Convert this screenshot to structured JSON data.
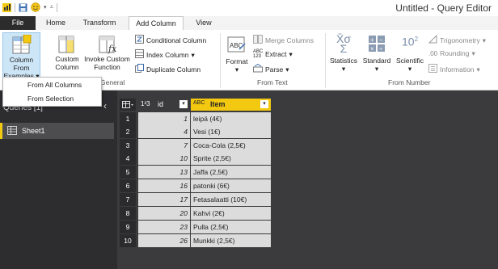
{
  "window": {
    "title": "Untitled - Query Editor"
  },
  "tabs": [
    {
      "label": "File"
    },
    {
      "label": "Home"
    },
    {
      "label": "Transform"
    },
    {
      "label": "Add Column"
    },
    {
      "label": "View"
    }
  ],
  "ribbon": {
    "general": {
      "group_label": "General",
      "column_from_examples": [
        "Column From",
        "Examples"
      ],
      "custom_column": [
        "Custom",
        "Column"
      ],
      "invoke_custom_function": [
        "Invoke Custom",
        "Function"
      ],
      "conditional_column": "Conditional Column",
      "index_column": "Index Column",
      "duplicate_column": "Duplicate Column"
    },
    "from_text": {
      "group_label": "From Text",
      "format": "Format",
      "merge_columns": "Merge Columns",
      "extract": "Extract",
      "parse": "Parse",
      "abc_icon": "ABC",
      "abc123_icon": [
        "ABC",
        "123"
      ]
    },
    "from_number": {
      "group_label": "From Number",
      "statistics": "Statistics",
      "standard": "Standard",
      "scientific": "Scientific",
      "trigonometry": "Trigonometry",
      "rounding": "Rounding",
      "information": "Information",
      "ten_squared": "10",
      "exponent": "2"
    }
  },
  "dropdown": {
    "items": [
      "From All Columns",
      "From Selection"
    ]
  },
  "queries": {
    "header": "Queries [1]",
    "items": [
      {
        "name": "Sheet1"
      }
    ]
  },
  "table": {
    "columns": [
      {
        "name": "id",
        "type_icon": "1²3"
      },
      {
        "name": "Item",
        "type_icon": "ABC"
      }
    ],
    "rows": [
      {
        "n": "1",
        "id": "1",
        "item": "leipä (4€)"
      },
      {
        "n": "2",
        "id": "4",
        "item": "Vesi (1€)"
      },
      {
        "n": "3",
        "id": "7",
        "item": "Coca-Cola (2,5€)"
      },
      {
        "n": "4",
        "id": "10",
        "item": "Sprite (2,5€)"
      },
      {
        "n": "5",
        "id": "13",
        "item": "Jaffa (2,5€)"
      },
      {
        "n": "6",
        "id": "16",
        "item": "patonki  (6€)"
      },
      {
        "n": "7",
        "id": "17",
        "item": "Fetasalaatti (10€)"
      },
      {
        "n": "8",
        "id": "20",
        "item": "Kahvi (2€)"
      },
      {
        "n": "9",
        "id": "23",
        "item": "Pulla (2,5€)"
      },
      {
        "n": "10",
        "id": "26",
        "item": "Munkki (2,5€)"
      }
    ]
  },
  "colors": {
    "accent_yellow": "#f2c811",
    "dark_pane": "#2d2d30",
    "grid_bg": "#3b3b3e",
    "selection_blue": "#cde6f7"
  }
}
